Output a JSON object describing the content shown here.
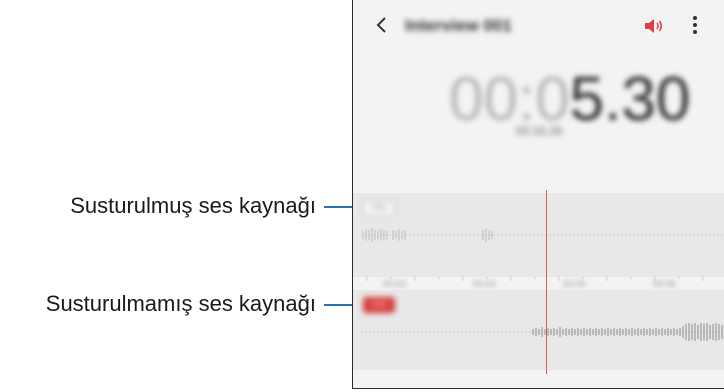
{
  "callouts": {
    "muted_source": "Susturulmuş ses kaynağı",
    "unmuted_source": "Susturulmamış ses kaynağı"
  },
  "app": {
    "title": "Interview 001",
    "timer_prefix": "00:0",
    "timer_main": "5.30",
    "subtime": "00:16.26",
    "timeline_labels": [
      "00:03",
      "00:04",
      "00:05",
      "00:06"
    ],
    "tracks": {
      "muted_tag": "000",
      "unmuted_tag": "000"
    }
  },
  "colors": {
    "accent_red": "#d9413f",
    "playhead": "#e05a5a",
    "leader_line": "#2c6fb0",
    "track_bg": "#e8e8e8"
  },
  "icons": {
    "back": "chevron-left-icon",
    "speaker": "speaker-icon",
    "more": "more-vertical-icon"
  }
}
